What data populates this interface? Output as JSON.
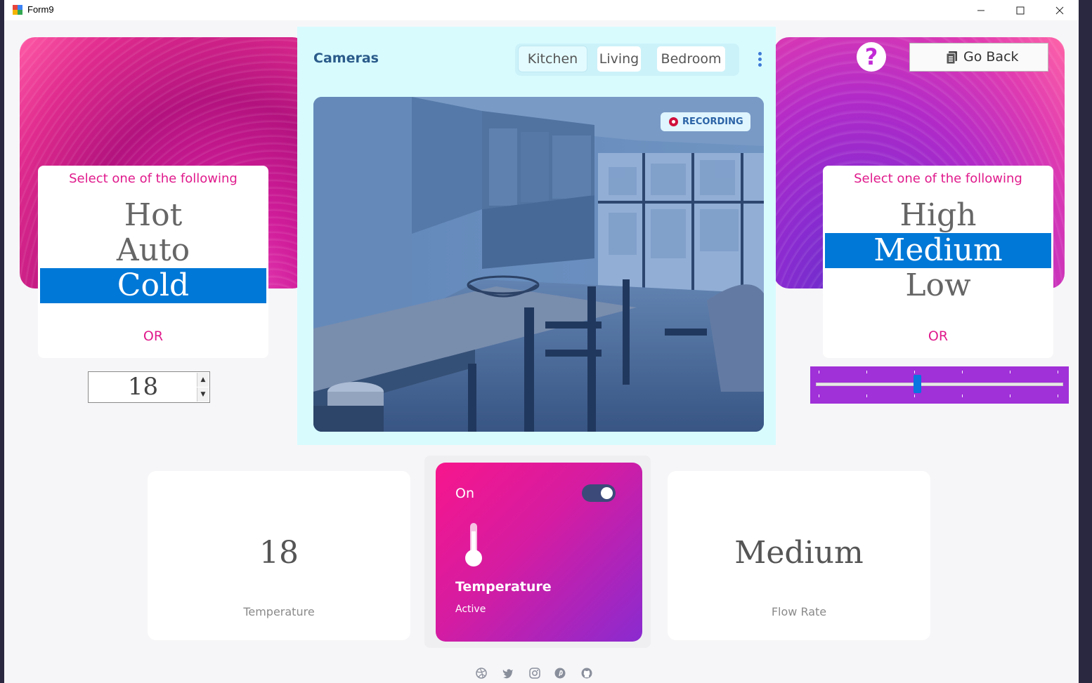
{
  "window": {
    "title": "Form9",
    "minimize_glyph": "—",
    "maximize_glyph": "☐",
    "close_glyph": "✕"
  },
  "left_select": {
    "heading": "Select one of the following",
    "options": [
      "Hot",
      "Auto",
      "Cold"
    ],
    "selected": "Cold",
    "or_label": "OR"
  },
  "temperature_spinner": {
    "value": "18",
    "up_glyph": "▲",
    "down_glyph": "▼"
  },
  "cameras": {
    "title": "Cameras",
    "tabs": [
      "Kitchen",
      "Living",
      "Bedroom"
    ],
    "active_tab": "Kitchen",
    "recording_label": "RECORDING",
    "more_icon": "kebab-vertical-icon"
  },
  "right_select": {
    "heading": "Select one of the following",
    "options": [
      "High",
      "Medium",
      "Low"
    ],
    "selected": "Medium",
    "or_label": "OR"
  },
  "flow_trackbar": {
    "value_fraction": 0.41,
    "ticks": 6
  },
  "help_button": {
    "label": "?"
  },
  "go_back_button": {
    "label": "Go Back",
    "icon": "document-icon"
  },
  "cards": {
    "temperature": {
      "value": "18",
      "label": "Temperature"
    },
    "active": {
      "state_label": "On",
      "toggle_on": true,
      "title": "Temperature",
      "status": "Active",
      "icon": "thermometer-icon"
    },
    "flow": {
      "value": "Medium",
      "label": "Flow Rate"
    }
  },
  "social_icons": [
    "dribbble-icon",
    "twitter-icon",
    "instagram-icon",
    "pinterest-icon",
    "github-icon"
  ],
  "colors": {
    "accent_pink": "#e01a8c",
    "selection_blue": "#0078d7",
    "trackbar_purple": "#a030d8",
    "camera_panel": "#d8fbfe"
  }
}
